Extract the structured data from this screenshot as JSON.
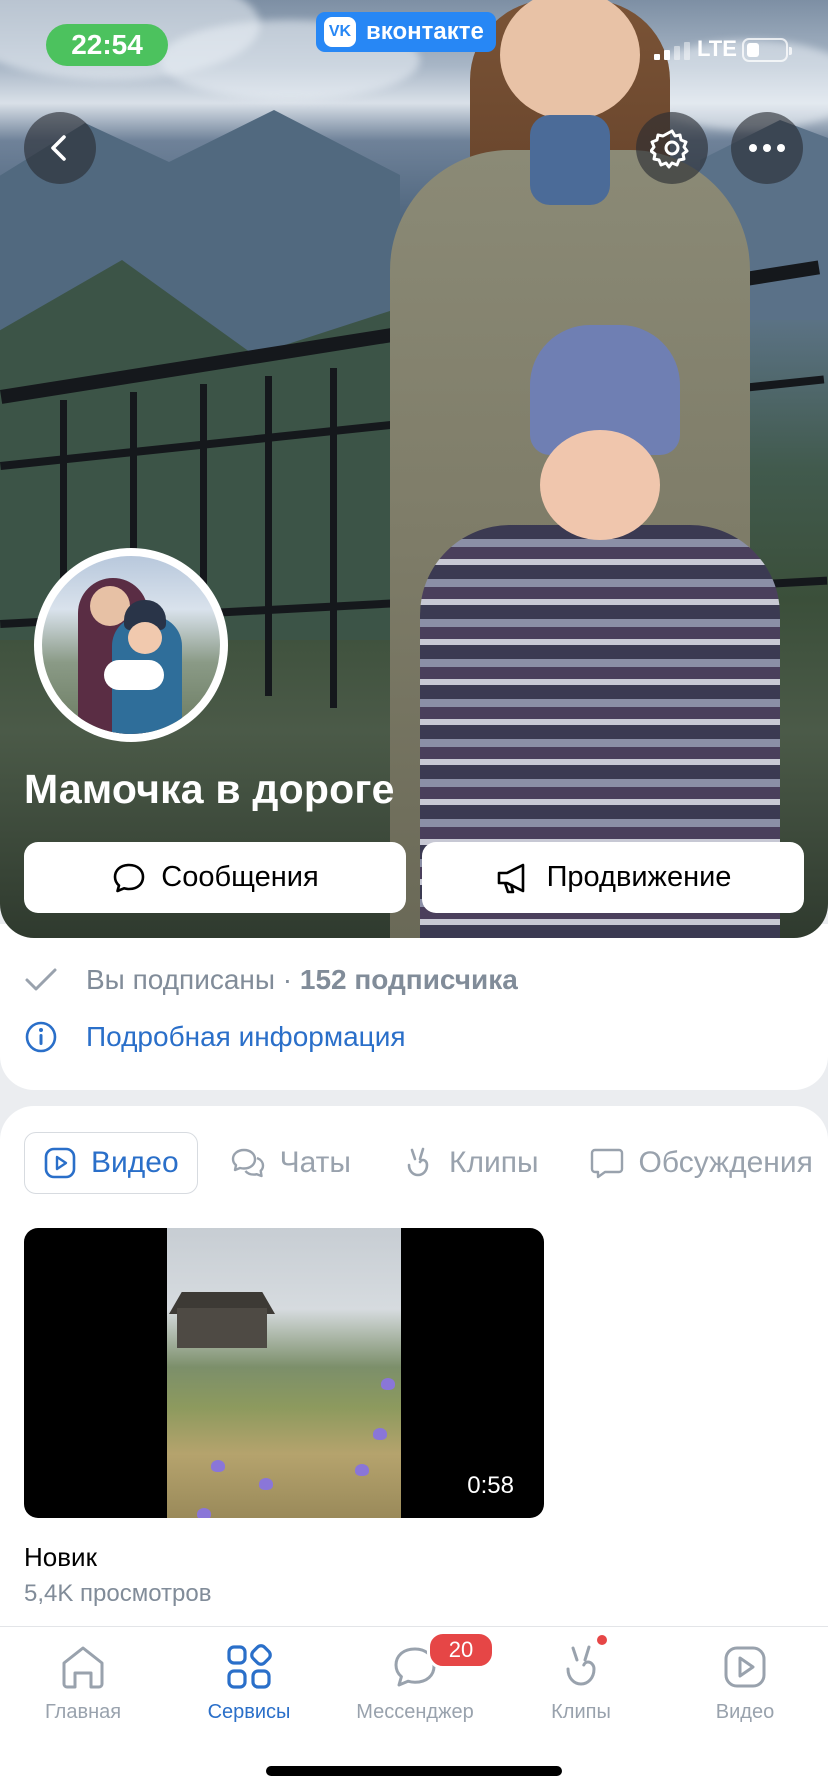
{
  "status_bar": {
    "time": "22:54",
    "network": "LTE",
    "app_badge": "вконтакте"
  },
  "community": {
    "name": "Мамочка в дороге",
    "subscribed_text": "Вы подписаны · ",
    "subscribers": "152 подписчика",
    "more_info": "Подробная информация"
  },
  "header_buttons": {
    "back_icon": "chevron-left-icon",
    "settings_icon": "gear-icon",
    "more_icon": "more-dots-icon"
  },
  "actions": {
    "messages": "Сообщения",
    "promotion": "Продвижение"
  },
  "tabs": [
    {
      "label": "Видео",
      "icon": "video-icon",
      "active": true
    },
    {
      "label": "Чаты",
      "icon": "chats-icon",
      "active": false
    },
    {
      "label": "Клипы",
      "icon": "clips-icon",
      "active": false
    },
    {
      "label": "Обсуждения",
      "icon": "discussions-icon",
      "active": false
    }
  ],
  "videos": [
    {
      "title": "Новик",
      "views": "5,4K просмотров",
      "duration": "0:58"
    }
  ],
  "bottom_nav": [
    {
      "label": "Главная",
      "icon": "home-icon",
      "active": false
    },
    {
      "label": "Сервисы",
      "icon": "services-icon",
      "active": true
    },
    {
      "label": "Мессенджер",
      "icon": "messenger-icon",
      "active": false,
      "badge": "20"
    },
    {
      "label": "Клипы",
      "icon": "clips-icon",
      "active": false,
      "dot": true
    },
    {
      "label": "Видео",
      "icon": "video-icon",
      "active": false
    }
  ],
  "colors": {
    "accent": "#2a6fc9",
    "vk_blue": "#2787f5",
    "badge_red": "#e64646",
    "time_green": "#4cc25e"
  }
}
